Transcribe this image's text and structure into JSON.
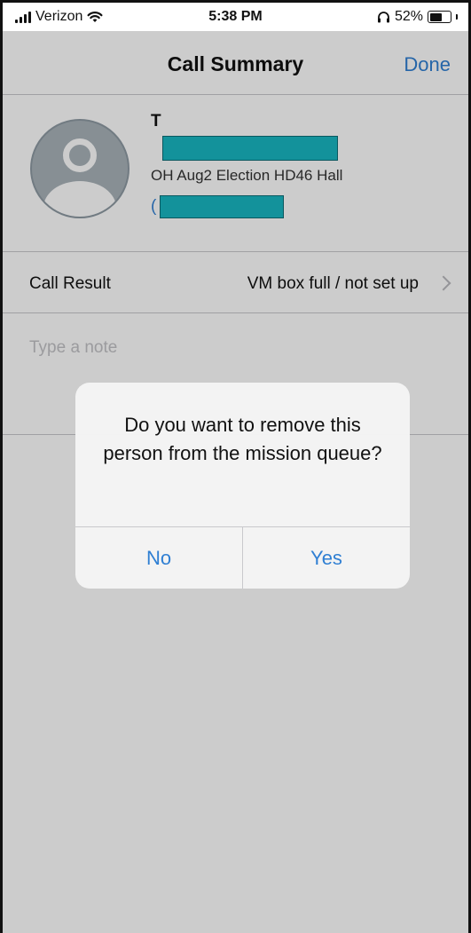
{
  "status_bar": {
    "carrier": "Verizon",
    "time": "5:38 PM",
    "battery_percent": "52%",
    "battery_level": 0.52
  },
  "nav": {
    "title": "Call Summary",
    "done_label": "Done"
  },
  "contact": {
    "name_visible": "T",
    "campaign": "OH Aug2 Election HD46 Hall",
    "phone_visible": "("
  },
  "call_result": {
    "label": "Call Result",
    "value": "VM box full / not set up"
  },
  "note": {
    "placeholder": "Type a note"
  },
  "alert": {
    "message": "Do you want to remove this person from the mission queue?",
    "no_label": "No",
    "yes_label": "Yes"
  },
  "colors": {
    "accent": "#2f7fd3",
    "redaction": "#18b7c2",
    "avatar": "#a9b3ba"
  },
  "icons": [
    "cellular-signal-icon",
    "wifi-icon",
    "headphones-icon",
    "battery-icon",
    "avatar-placeholder-icon",
    "chevron-right-icon"
  ]
}
